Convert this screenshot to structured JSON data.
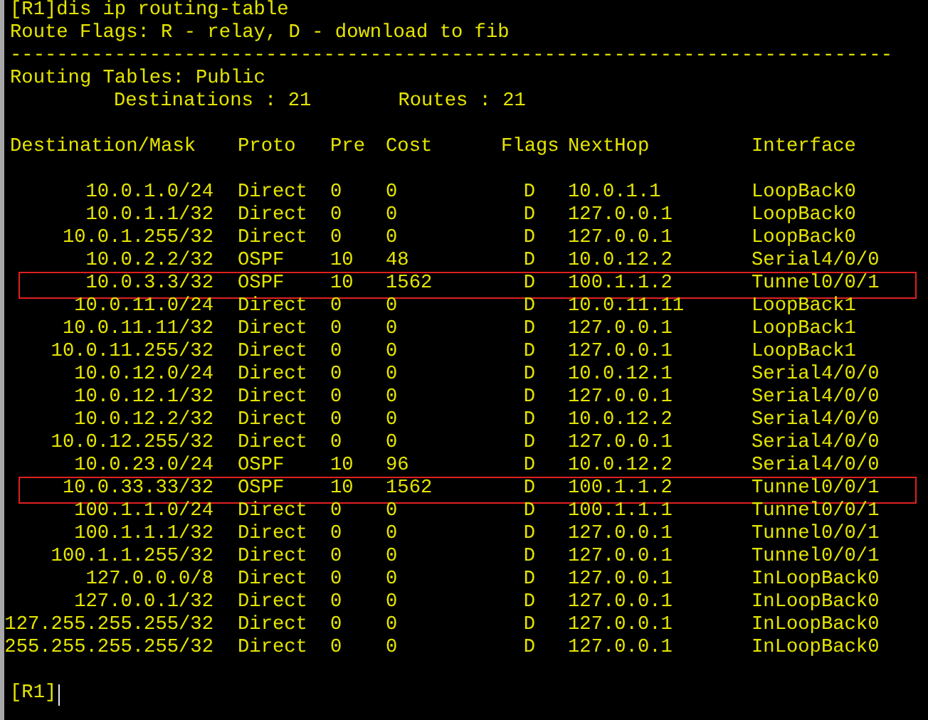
{
  "lines": [
    "[R1]dis ip routing-table",
    "Route Flags: R - relay, D - download to fib",
    "----------------------------------------------------------------------------",
    "Routing Tables: Public"
  ],
  "summary": {
    "destinations": "Destinations : 21",
    "routes": "Routes : 21"
  },
  "columns": [
    "Destination/Mask",
    "Proto",
    "Pre",
    "Cost",
    "Flags",
    "NextHop",
    "Interface"
  ],
  "rows": [
    {
      "cells": [
        "10.0.1.0/24",
        "Direct",
        "0",
        "0",
        "D",
        "10.0.1.1",
        "LoopBack0"
      ],
      "highlighted": false
    },
    {
      "cells": [
        "10.0.1.1/32",
        "Direct",
        "0",
        "0",
        "D",
        "127.0.0.1",
        "LoopBack0"
      ],
      "highlighted": false
    },
    {
      "cells": [
        "10.0.1.255/32",
        "Direct",
        "0",
        "0",
        "D",
        "127.0.0.1",
        "LoopBack0"
      ],
      "highlighted": false
    },
    {
      "cells": [
        "10.0.2.2/32",
        "OSPF",
        "10",
        "48",
        "D",
        "10.0.12.2",
        "Serial4/0/0"
      ],
      "highlighted": false
    },
    {
      "cells": [
        "10.0.3.3/32",
        "OSPF",
        "10",
        "1562",
        "D",
        "100.1.1.2",
        "Tunnel0/0/1"
      ],
      "highlighted": true
    },
    {
      "cells": [
        "10.0.11.0/24",
        "Direct",
        "0",
        "0",
        "D",
        "10.0.11.11",
        "LoopBack1"
      ],
      "highlighted": false
    },
    {
      "cells": [
        "10.0.11.11/32",
        "Direct",
        "0",
        "0",
        "D",
        "127.0.0.1",
        "LoopBack1"
      ],
      "highlighted": false
    },
    {
      "cells": [
        "10.0.11.255/32",
        "Direct",
        "0",
        "0",
        "D",
        "127.0.0.1",
        "LoopBack1"
      ],
      "highlighted": false
    },
    {
      "cells": [
        "10.0.12.0/24",
        "Direct",
        "0",
        "0",
        "D",
        "10.0.12.1",
        "Serial4/0/0"
      ],
      "highlighted": false
    },
    {
      "cells": [
        "10.0.12.1/32",
        "Direct",
        "0",
        "0",
        "D",
        "127.0.0.1",
        "Serial4/0/0"
      ],
      "highlighted": false
    },
    {
      "cells": [
        "10.0.12.2/32",
        "Direct",
        "0",
        "0",
        "D",
        "10.0.12.2",
        "Serial4/0/0"
      ],
      "highlighted": false
    },
    {
      "cells": [
        "10.0.12.255/32",
        "Direct",
        "0",
        "0",
        "D",
        "127.0.0.1",
        "Serial4/0/0"
      ],
      "highlighted": false
    },
    {
      "cells": [
        "10.0.23.0/24",
        "OSPF",
        "10",
        "96",
        "D",
        "10.0.12.2",
        "Serial4/0/0"
      ],
      "highlighted": false
    },
    {
      "cells": [
        "10.0.33.33/32",
        "OSPF",
        "10",
        "1562",
        "D",
        "100.1.1.2",
        "Tunnel0/0/1"
      ],
      "highlighted": true
    },
    {
      "cells": [
        "100.1.1.0/24",
        "Direct",
        "0",
        "0",
        "D",
        "100.1.1.1",
        "Tunnel0/0/1"
      ],
      "highlighted": false
    },
    {
      "cells": [
        "100.1.1.1/32",
        "Direct",
        "0",
        "0",
        "D",
        "127.0.0.1",
        "Tunnel0/0/1"
      ],
      "highlighted": false
    },
    {
      "cells": [
        "100.1.1.255/32",
        "Direct",
        "0",
        "0",
        "D",
        "127.0.0.1",
        "Tunnel0/0/1"
      ],
      "highlighted": false
    },
    {
      "cells": [
        "127.0.0.0/8",
        "Direct",
        "0",
        "0",
        "D",
        "127.0.0.1",
        "InLoopBack0"
      ],
      "highlighted": false
    },
    {
      "cells": [
        "127.0.0.1/32",
        "Direct",
        "0",
        "0",
        "D",
        "127.0.0.1",
        "InLoopBack0"
      ],
      "highlighted": false
    },
    {
      "cells": [
        "127.255.255.255/32",
        "Direct",
        "0",
        "0",
        "D",
        "127.0.0.1",
        "InLoopBack0"
      ],
      "highlighted": false
    },
    {
      "cells": [
        "255.255.255.255/32",
        "Direct",
        "0",
        "0",
        "D",
        "127.0.0.1",
        "InLoopBack0"
      ],
      "highlighted": false
    }
  ],
  "prompt": "[R1]"
}
